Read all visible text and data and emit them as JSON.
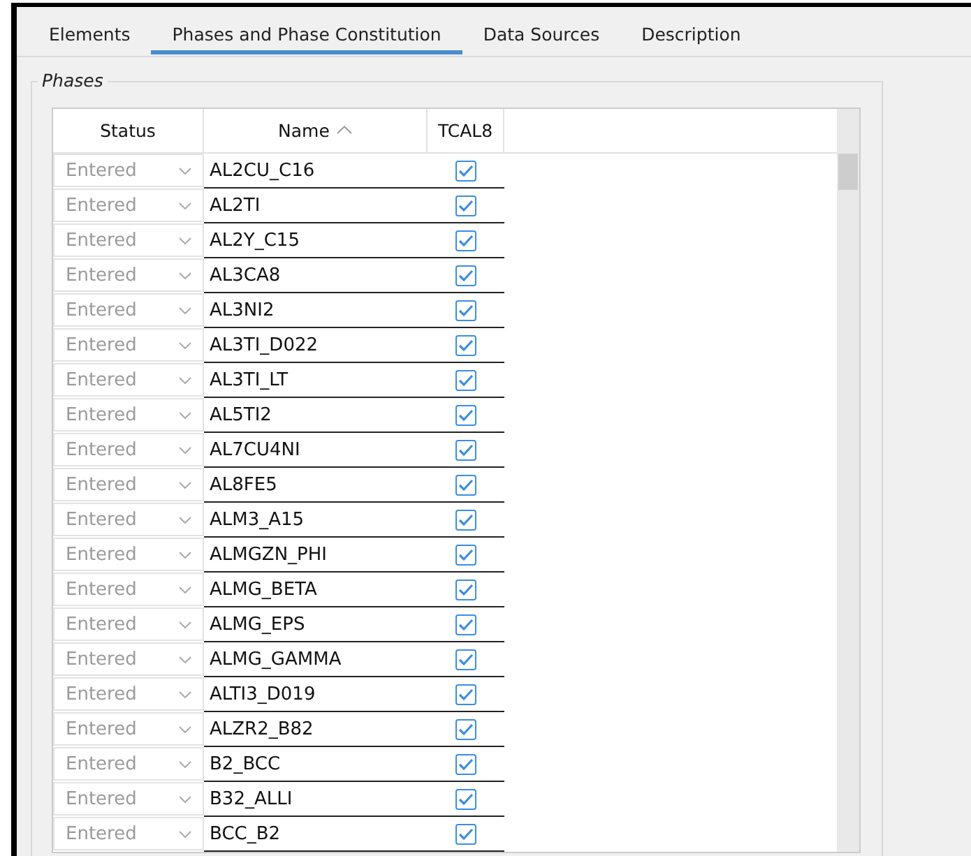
{
  "tabs": [
    {
      "label": "Elements",
      "selected": false
    },
    {
      "label": "Phases and Phase Constitution",
      "selected": true
    },
    {
      "label": "Data Sources",
      "selected": false
    },
    {
      "label": "Description",
      "selected": false
    }
  ],
  "group": {
    "title": "Phases"
  },
  "table": {
    "columns": [
      {
        "label": "Status",
        "sorted": false
      },
      {
        "label": "Name",
        "sorted": true
      },
      {
        "label": "TCAL8",
        "sorted": false
      }
    ],
    "rows": [
      {
        "status": "Entered",
        "name": "AL2CU_C16",
        "checked": true
      },
      {
        "status": "Entered",
        "name": "AL2TI",
        "checked": true
      },
      {
        "status": "Entered",
        "name": "AL2Y_C15",
        "checked": true
      },
      {
        "status": "Entered",
        "name": "AL3CA8",
        "checked": true
      },
      {
        "status": "Entered",
        "name": "AL3NI2",
        "checked": true
      },
      {
        "status": "Entered",
        "name": "AL3TI_D022",
        "checked": true
      },
      {
        "status": "Entered",
        "name": "AL3TI_LT",
        "checked": true
      },
      {
        "status": "Entered",
        "name": "AL5TI2",
        "checked": true
      },
      {
        "status": "Entered",
        "name": "AL7CU4NI",
        "checked": true
      },
      {
        "status": "Entered",
        "name": "AL8FE5",
        "checked": true
      },
      {
        "status": "Entered",
        "name": "ALM3_A15",
        "checked": true
      },
      {
        "status": "Entered",
        "name": "ALMGZN_PHI",
        "checked": true
      },
      {
        "status": "Entered",
        "name": "ALMG_BETA",
        "checked": true
      },
      {
        "status": "Entered",
        "name": "ALMG_EPS",
        "checked": true
      },
      {
        "status": "Entered",
        "name": "ALMG_GAMMA",
        "checked": true
      },
      {
        "status": "Entered",
        "name": "ALTI3_D019",
        "checked": true
      },
      {
        "status": "Entered",
        "name": "ALZR2_B82",
        "checked": true
      },
      {
        "status": "Entered",
        "name": "B2_BCC",
        "checked": true
      },
      {
        "status": "Entered",
        "name": "B32_ALLI",
        "checked": true
      },
      {
        "status": "Entered",
        "name": "BCC_B2",
        "checked": true
      }
    ]
  }
}
